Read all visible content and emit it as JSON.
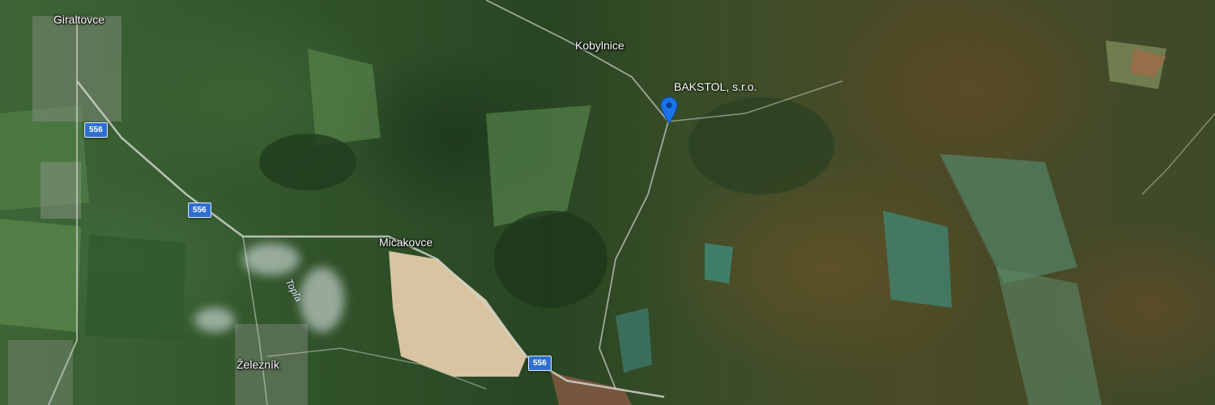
{
  "map": {
    "view": "satellite",
    "places": {
      "giraltovce": "Giraltovce",
      "kobylnice": "Kobylnice",
      "micakovce": "Mičakovce",
      "zeleznik": "Železník"
    },
    "river": "Topľa",
    "road_shields": [
      "556",
      "556",
      "556"
    ],
    "poi": {
      "name": "BAKSTOL, s.r.o.",
      "marker_color": "#1a73e8",
      "icon": "map-pin-icon"
    }
  }
}
